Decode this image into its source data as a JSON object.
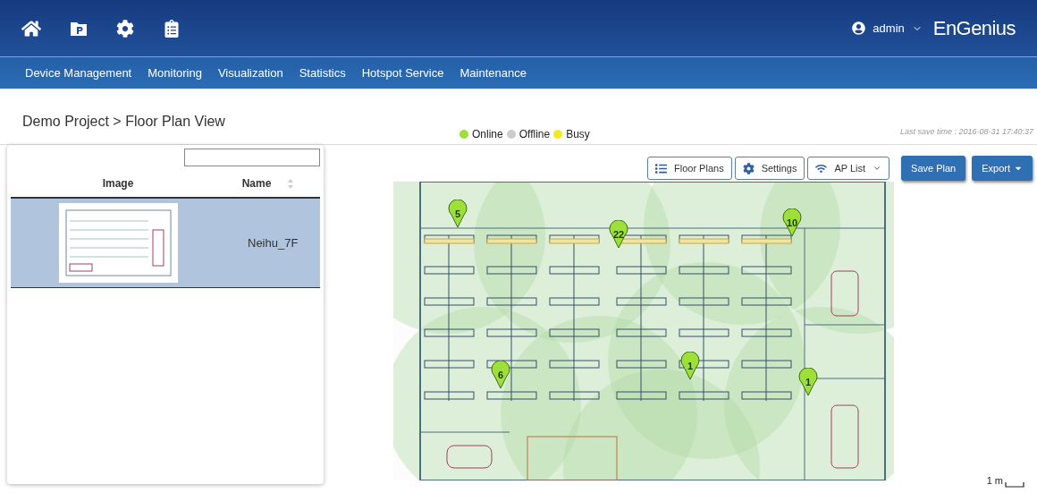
{
  "header": {
    "user": "admin",
    "brand": "EnGenius"
  },
  "nav": [
    "Device Management",
    "Monitoring",
    "Visualization",
    "Statistics",
    "Hotspot Service",
    "Maintenance"
  ],
  "breadcrumb": "Demo Project > Floor Plan View",
  "legend": [
    {
      "label": "Online",
      "color": "#9de03a"
    },
    {
      "label": "Offline",
      "color": "#cccccc"
    },
    {
      "label": "Busy",
      "color": "#f2ea1c"
    }
  ],
  "last_save": "Last save time : 2016-08-31 17:40:37",
  "floor_plans": {
    "columns": [
      "Image",
      "Name"
    ],
    "rows": [
      {
        "name": "Neihu_7F",
        "selected": true
      }
    ]
  },
  "toolbar": [
    {
      "kind": "list",
      "label": "Floor Plans"
    },
    {
      "kind": "gear",
      "label": "Settings"
    },
    {
      "kind": "wifi",
      "label": "AP List"
    }
  ],
  "actions": [
    {
      "label": "Save Plan",
      "dropdown": false
    },
    {
      "label": "Export",
      "dropdown": true
    }
  ],
  "aps": [
    {
      "label": "5"
    },
    {
      "label": "22"
    },
    {
      "label": "10"
    },
    {
      "label": "6"
    },
    {
      "label": "1"
    },
    {
      "label": "1"
    }
  ],
  "scale": "1 m"
}
